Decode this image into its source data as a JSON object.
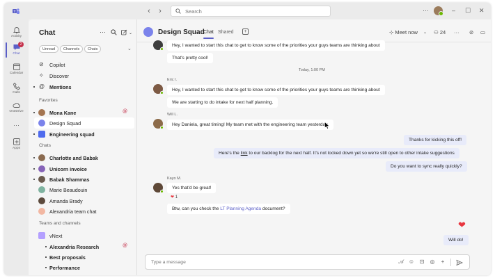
{
  "app": {
    "window_controls": {
      "more": "···",
      "minimize": "–",
      "maximize": "☐",
      "close": "✕"
    }
  },
  "search": {
    "placeholder": "Search"
  },
  "rail": {
    "items": [
      {
        "label": "Activity"
      },
      {
        "label": "Chat",
        "badge": "2"
      },
      {
        "label": "Calendar"
      },
      {
        "label": "Calls"
      },
      {
        "label": "OneDrive"
      },
      {
        "label": "···"
      },
      {
        "label": "Apps"
      }
    ]
  },
  "chatlist": {
    "title": "Chat",
    "filters": [
      "Unread",
      "Channels",
      "Chats"
    ],
    "top_items": [
      {
        "label": "Copilot"
      },
      {
        "label": "Discover"
      },
      {
        "label": "Mentions"
      }
    ],
    "favorites_label": "Favorites",
    "favorites": [
      {
        "name": "Mona Kane"
      },
      {
        "name": "Design Squad"
      },
      {
        "name": "Engineering squad"
      }
    ],
    "chats_label": "Chats",
    "chats": [
      {
        "name": "Charlotte and Babak"
      },
      {
        "name": "Unicorn invoice"
      },
      {
        "name": "Babak Shammas"
      },
      {
        "name": "Marie Beaudouin"
      },
      {
        "name": "Amanda Brady"
      },
      {
        "name": "Alexandria team chat"
      }
    ],
    "teams_label": "Teams and channels",
    "teams": [
      {
        "name": "vNext"
      },
      {
        "name": "Alexandria Research"
      },
      {
        "name": "Best proposals"
      },
      {
        "name": "Performance"
      }
    ]
  },
  "conversation": {
    "title": "Design Squad",
    "tabs": [
      "Chat",
      "Shared"
    ],
    "meet_now": "Meet now",
    "participants": "24",
    "timestamp": "Today, 1:00 PM",
    "messages": [
      {
        "sender": "",
        "text": "Hey, I wanted to start this chat to get to know some of the priorities your guys teams are thinking about"
      },
      {
        "sender": "",
        "text": "That's pretty cool!"
      },
      {
        "sender": "Eric I.",
        "text": "Hey, I wanted to start this chat to get to know some of the priorities your guys teams are thinking about"
      },
      {
        "sender": "",
        "text": "We are starting to do intake for next half planning."
      },
      {
        "sender": "Will L.",
        "text": "Hey Daniela, great timing! My team met with the engineering team yesterday."
      },
      {
        "sender": "me",
        "text": "Thanks for kicking this off!"
      },
      {
        "sender": "me",
        "text_before": "Here's the ",
        "link": "link",
        "text_after": " to our backlog for the next half. It's not locked down yet so we're still open to other intake suggestions"
      },
      {
        "sender": "me",
        "text": "Do you want to sync really quickly?"
      },
      {
        "sender": "Kayo M.",
        "text": "Yes that'd be great!"
      },
      {
        "sender": "",
        "text_before": "Btw, can you check the ",
        "link": "LT Planning Agenda",
        "text_after": " document?"
      },
      {
        "sender": "me",
        "text": "Will do!"
      }
    ],
    "reaction_count": "1"
  },
  "composer": {
    "placeholder": "Type a message"
  },
  "colors": {
    "brand": "#5b5fc7",
    "me_bubble": "#e8ebfa",
    "presence": "#6bb700",
    "mention": "#c4314b"
  }
}
